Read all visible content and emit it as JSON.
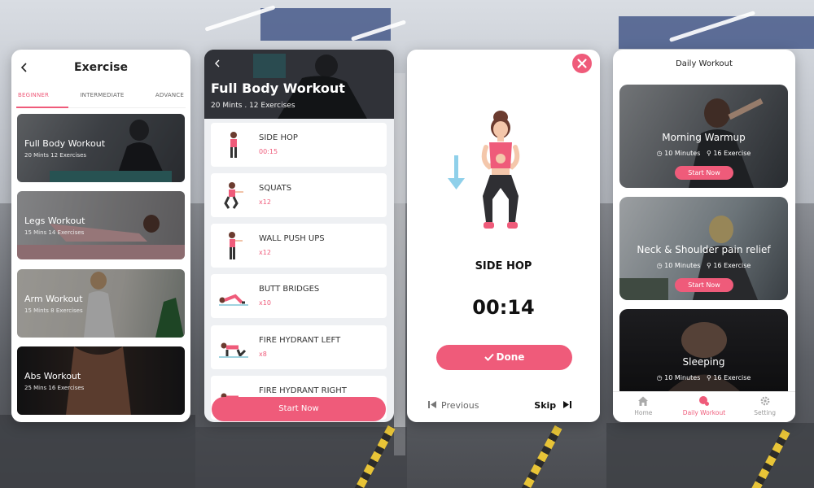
{
  "exercise_screen": {
    "title": "Exercise",
    "tabs": [
      {
        "label": "BEGINNER",
        "active": true
      },
      {
        "label": "INTERMEDIATE",
        "active": false
      },
      {
        "label": "ADVANCE",
        "active": false
      }
    ],
    "workouts": [
      {
        "name": "Full Body Workout",
        "meta": "20 Mints 12 Exercises"
      },
      {
        "name": "Legs Workout",
        "meta": "15 Mins 14 Exercises"
      },
      {
        "name": "Arm Workout",
        "meta": "15 Mints 8 Exercises"
      },
      {
        "name": "Abs Workout",
        "meta": "25 Mins 16 Exercises"
      }
    ]
  },
  "workout_detail": {
    "title": "Full Body Workout",
    "meta": "20 Mints . 12 Exercises",
    "exercises": [
      {
        "name": "SIDE HOP",
        "value": "00:15"
      },
      {
        "name": "SQUATS",
        "value": "x12"
      },
      {
        "name": "WALL PUSH UPS",
        "value": "x12"
      },
      {
        "name": "BUTT BRIDGES",
        "value": "x10"
      },
      {
        "name": "FIRE HYDRANT LEFT",
        "value": "x8"
      },
      {
        "name": "FIRE HYDRANT RIGHT",
        "value": ""
      }
    ],
    "start_label": "Start Now"
  },
  "exercise_player": {
    "exercise_name": "SIDE HOP",
    "timer": "00:14",
    "done_label": "Done",
    "previous_label": "Previous",
    "skip_label": "Skip"
  },
  "daily_workout": {
    "title": "Daily Workout",
    "cards": [
      {
        "name": "Morning Warmup",
        "minutes": "10 Minutes",
        "exercises": "16 Exercise",
        "button": "Start Now"
      },
      {
        "name": "Neck & Shoulder pain relief",
        "minutes": "10 Minutes",
        "exercises": "16 Exercise",
        "button": "Start Now"
      },
      {
        "name": "Sleeping",
        "minutes": "10 Minutes",
        "exercises": "16 Exercise",
        "button": ""
      }
    ],
    "nav": [
      {
        "label": "Home",
        "icon": "home-icon",
        "active": false
      },
      {
        "label": "Daily Workout",
        "icon": "daily-workout-icon",
        "active": true
      },
      {
        "label": "Setting",
        "icon": "gear-icon",
        "active": false
      }
    ]
  },
  "colors": {
    "accent": "#ef5b7a",
    "text_dark": "#222222",
    "muted": "#999999"
  }
}
